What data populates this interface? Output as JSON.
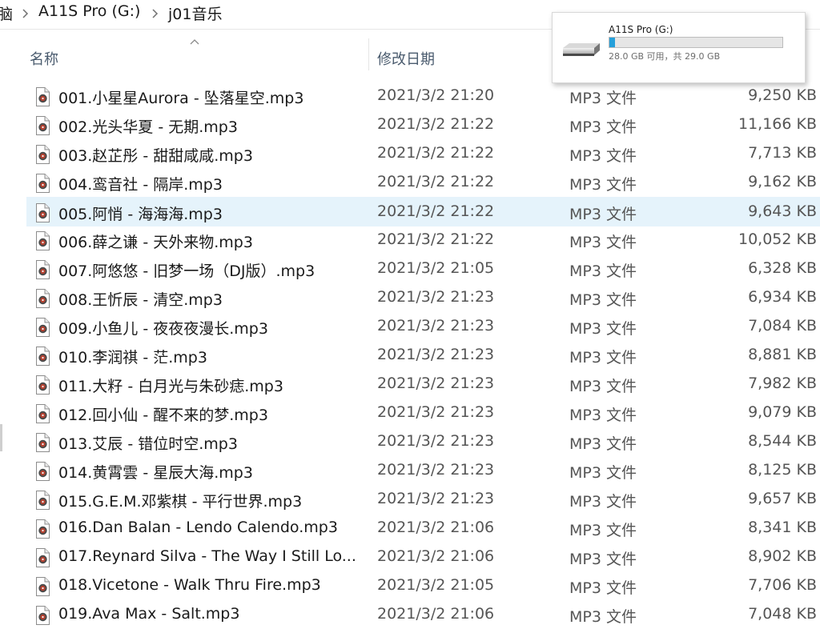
{
  "breadcrumb": {
    "items": [
      "脑",
      "A11S Pro (G:)",
      "j01音乐"
    ]
  },
  "columns": {
    "name": "名称",
    "date": "修改日期"
  },
  "tooltip": {
    "drive_name": "A11S Pro (G:)",
    "free_info": "28.0 GB 可用，共 29.0 GB",
    "used_fraction": 0.034
  },
  "files": [
    {
      "name": "001.小星星Aurora - 坠落星空.mp3",
      "date": "2021/3/2 21:20",
      "type": "MP3 文件",
      "size": "9,250 KB"
    },
    {
      "name": "002.光头华夏 - 无期.mp3",
      "date": "2021/3/2 21:22",
      "type": "MP3 文件",
      "size": "11,166 KB"
    },
    {
      "name": "003.赵芷彤 - 甜甜咸咸.mp3",
      "date": "2021/3/2 21:22",
      "type": "MP3 文件",
      "size": "7,713 KB"
    },
    {
      "name": "004.鸾音社 - 隔岸.mp3",
      "date": "2021/3/2 21:22",
      "type": "MP3 文件",
      "size": "9,162 KB"
    },
    {
      "name": "005.阿悄 - 海海海.mp3",
      "date": "2021/3/2 21:22",
      "type": "MP3 文件",
      "size": "9,643 KB"
    },
    {
      "name": "006.薛之谦 - 天外来物.mp3",
      "date": "2021/3/2 21:22",
      "type": "MP3 文件",
      "size": "10,052 KB"
    },
    {
      "name": "007.阿悠悠 - 旧梦一场（DJ版）.mp3",
      "date": "2021/3/2 21:05",
      "type": "MP3 文件",
      "size": "6,328 KB"
    },
    {
      "name": "008.王忻辰 - 清空.mp3",
      "date": "2021/3/2 21:23",
      "type": "MP3 文件",
      "size": "6,934 KB"
    },
    {
      "name": "009.小鱼儿 - 夜夜夜漫长.mp3",
      "date": "2021/3/2 21:23",
      "type": "MP3 文件",
      "size": "7,084 KB"
    },
    {
      "name": "010.李润祺 - 茫.mp3",
      "date": "2021/3/2 21:23",
      "type": "MP3 文件",
      "size": "8,881 KB"
    },
    {
      "name": "011.大籽 - 白月光与朱砂痣.mp3",
      "date": "2021/3/2 21:23",
      "type": "MP3 文件",
      "size": "7,982 KB"
    },
    {
      "name": "012.回小仙 - 醒不来的梦.mp3",
      "date": "2021/3/2 21:23",
      "type": "MP3 文件",
      "size": "9,079 KB"
    },
    {
      "name": "013.艾辰 - 错位时空.mp3",
      "date": "2021/3/2 21:23",
      "type": "MP3 文件",
      "size": "8,544 KB"
    },
    {
      "name": "014.黄霄雲 - 星辰大海.mp3",
      "date": "2021/3/2 21:23",
      "type": "MP3 文件",
      "size": "8,125 KB"
    },
    {
      "name": "015.G.E.M.邓紫棋 - 平行世界.mp3",
      "date": "2021/3/2 21:23",
      "type": "MP3 文件",
      "size": "9,657 KB"
    },
    {
      "name": "016.Dan Balan - Lendo Calendo.mp3",
      "date": "2021/3/2 21:06",
      "type": "MP3 文件",
      "size": "8,341 KB"
    },
    {
      "name": "017.Reynard Silva - The Way I Still Lo...",
      "date": "2021/3/2 21:06",
      "type": "MP3 文件",
      "size": "8,902 KB"
    },
    {
      "name": "018.Vicetone - Walk Thru Fire.mp3",
      "date": "2021/3/2 21:05",
      "type": "MP3 文件",
      "size": "7,706 KB"
    },
    {
      "name": "019.Ava Max - Salt.mp3",
      "date": "2021/3/2 21:06",
      "type": "MP3 文件",
      "size": "7,048 KB"
    }
  ],
  "selected_index": 4
}
